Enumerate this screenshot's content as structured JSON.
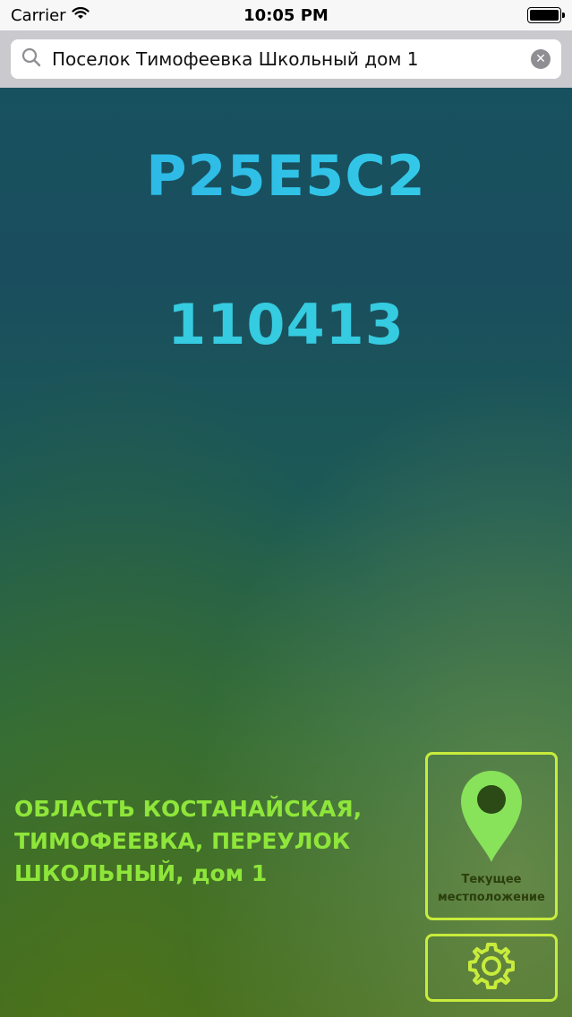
{
  "status_bar": {
    "carrier": "Carrier",
    "time": "10:05 PM",
    "icons": [
      "wifi-icon",
      "battery-icon"
    ]
  },
  "search": {
    "value": "Поселок Тимофеевка Школьный дом 1",
    "placeholder": "",
    "icon": "search-icon",
    "clear_icon": "clear-icon"
  },
  "main": {
    "code": "P25E5C2",
    "postal_code": "110413",
    "address": "ОБЛАСТЬ КОСТАНАЙСКАЯ, ТИМОФЕЕВКА, ПЕРЕУЛОК ШКОЛЬНЫЙ, дом 1"
  },
  "actions": {
    "current_location_label": "Текущее местположение",
    "current_location_icon": "map-pin-icon",
    "settings_icon": "gear-icon"
  },
  "colors": {
    "code_accent": "#2bb1e6",
    "address_green": "#8ee63a",
    "button_border": "#c8ec3c",
    "pin_green": "#88e25a"
  }
}
